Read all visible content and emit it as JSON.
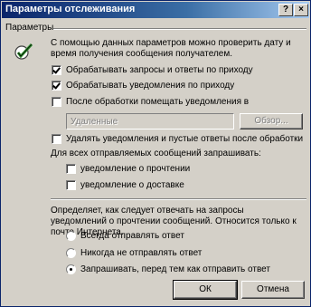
{
  "window": {
    "title": "Параметры отслеживания",
    "help_button": "?",
    "close_button": "×"
  },
  "settings": {
    "group_label": "Параметры",
    "description_line1": "С помощью данных параметров можно проверить дату и",
    "description_line2": "время получения сообщения получателем.",
    "process_requests": {
      "label": "Обрабатывать запросы и ответы по приходу",
      "checked": true
    },
    "process_receipts": {
      "label": "Обрабатывать уведомления по приходу",
      "checked": true
    },
    "move_receipts": {
      "label": "После обработки помещать уведомления в",
      "checked": false
    },
    "folder": {
      "value": "Удаленные",
      "browse_label": "Обзор..."
    },
    "delete_blank": {
      "label": "Удалять уведомления и пустые ответы после обработки",
      "checked": false
    },
    "request_for_all_label": "Для всех отправляемых сообщений запрашивать:",
    "read_receipt": {
      "label": "уведомление о прочтении",
      "checked": false
    },
    "delivery_receipt": {
      "label": "уведомление о доставке",
      "checked": false
    }
  },
  "response": {
    "description_line1": "Определяет, как следует отвечать на запросы",
    "description_line2": "уведомлений о прочтении сообщений. Относится только к",
    "description_line3": "почте Интернета.",
    "options": [
      {
        "label": "Всегда отправлять ответ",
        "selected": false
      },
      {
        "label": "Никогда не отправлять ответ",
        "selected": false
      },
      {
        "label": "Запрашивать, перед тем как отправить ответ",
        "selected": true
      }
    ]
  },
  "footer": {
    "ok_label": "ОК",
    "cancel_label": "Отмена"
  }
}
